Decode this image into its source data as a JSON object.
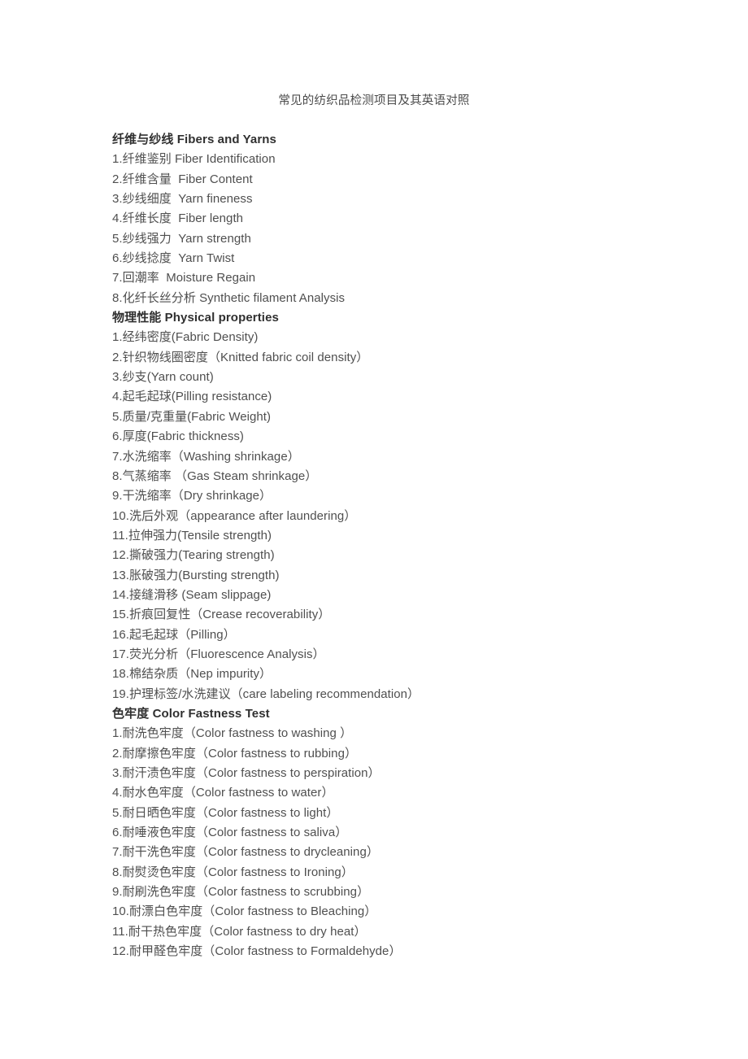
{
  "document": {
    "title": "常见的纺织品检测项目及其英语对照",
    "background_color": "#ffffff",
    "body_text_color": "#4f4f4f",
    "heading_text_color": "#303030"
  },
  "sections": [
    {
      "heading": "纤维与纱线 Fibers and Yarns",
      "items": [
        "1.纤维鉴别 Fiber Identification",
        "2.纤维含量  Fiber Content",
        "3.纱线细度  Yarn fineness",
        "4.纤维长度  Fiber length",
        "5.纱线强力  Yarn strength",
        "6.纱线捻度  Yarn Twist",
        "7.回潮率  Moisture Regain",
        "8.化纤长丝分析 Synthetic filament Analysis"
      ]
    },
    {
      "heading": "物理性能 Physical properties",
      "items": [
        "1.经纬密度(Fabric Density)",
        "2.针织物线圈密度（Knitted fabric coil density）",
        "3.纱支(Yarn count)",
        "4.起毛起球(Pilling resistance)",
        "5.质量/克重量(Fabric Weight)",
        "6.厚度(Fabric thickness)",
        "7.水洗缩率（Washing shrinkage）",
        "8.气蒸缩率 （Gas Steam shrinkage）",
        "9.干洗缩率（Dry shrinkage）",
        "10.洗后外观（appearance after laundering）",
        "11.拉伸强力(Tensile strength)",
        "12.撕破强力(Tearing strength)",
        "13.胀破强力(Bursting strength)",
        "14.接缝滑移 (Seam slippage)",
        "15.折痕回复性（Crease recoverability）",
        "16.起毛起球（Pilling）",
        "17.荧光分析（Fluorescence Analysis）",
        "18.棉结杂质（Nep impurity）",
        "19.护理标签/水洗建议（care labeling recommendation）"
      ]
    },
    {
      "heading": "色牢度 Color Fastness Test",
      "items": [
        "1.耐洗色牢度（Color fastness to washing ）",
        "2.耐摩擦色牢度（Color fastness to rubbing）",
        "3.耐汗渍色牢度（Color fastness to perspiration）",
        "4.耐水色牢度（Color fastness to water）",
        "5.耐日晒色牢度（Color fastness to light）",
        "6.耐唾液色牢度（Color fastness to saliva）",
        "7.耐干洗色牢度（Color fastness to drycleaning）",
        "8.耐熨烫色牢度（Color fastness to Ironing）",
        "9.耐刷洗色牢度（Color fastness to scrubbing）",
        "10.耐漂白色牢度（Color fastness to Bleaching）",
        "11.耐干热色牢度（Color fastness to dry heat）",
        "12.耐甲醛色牢度（Color fastness to Formaldehyde）"
      ]
    }
  ]
}
